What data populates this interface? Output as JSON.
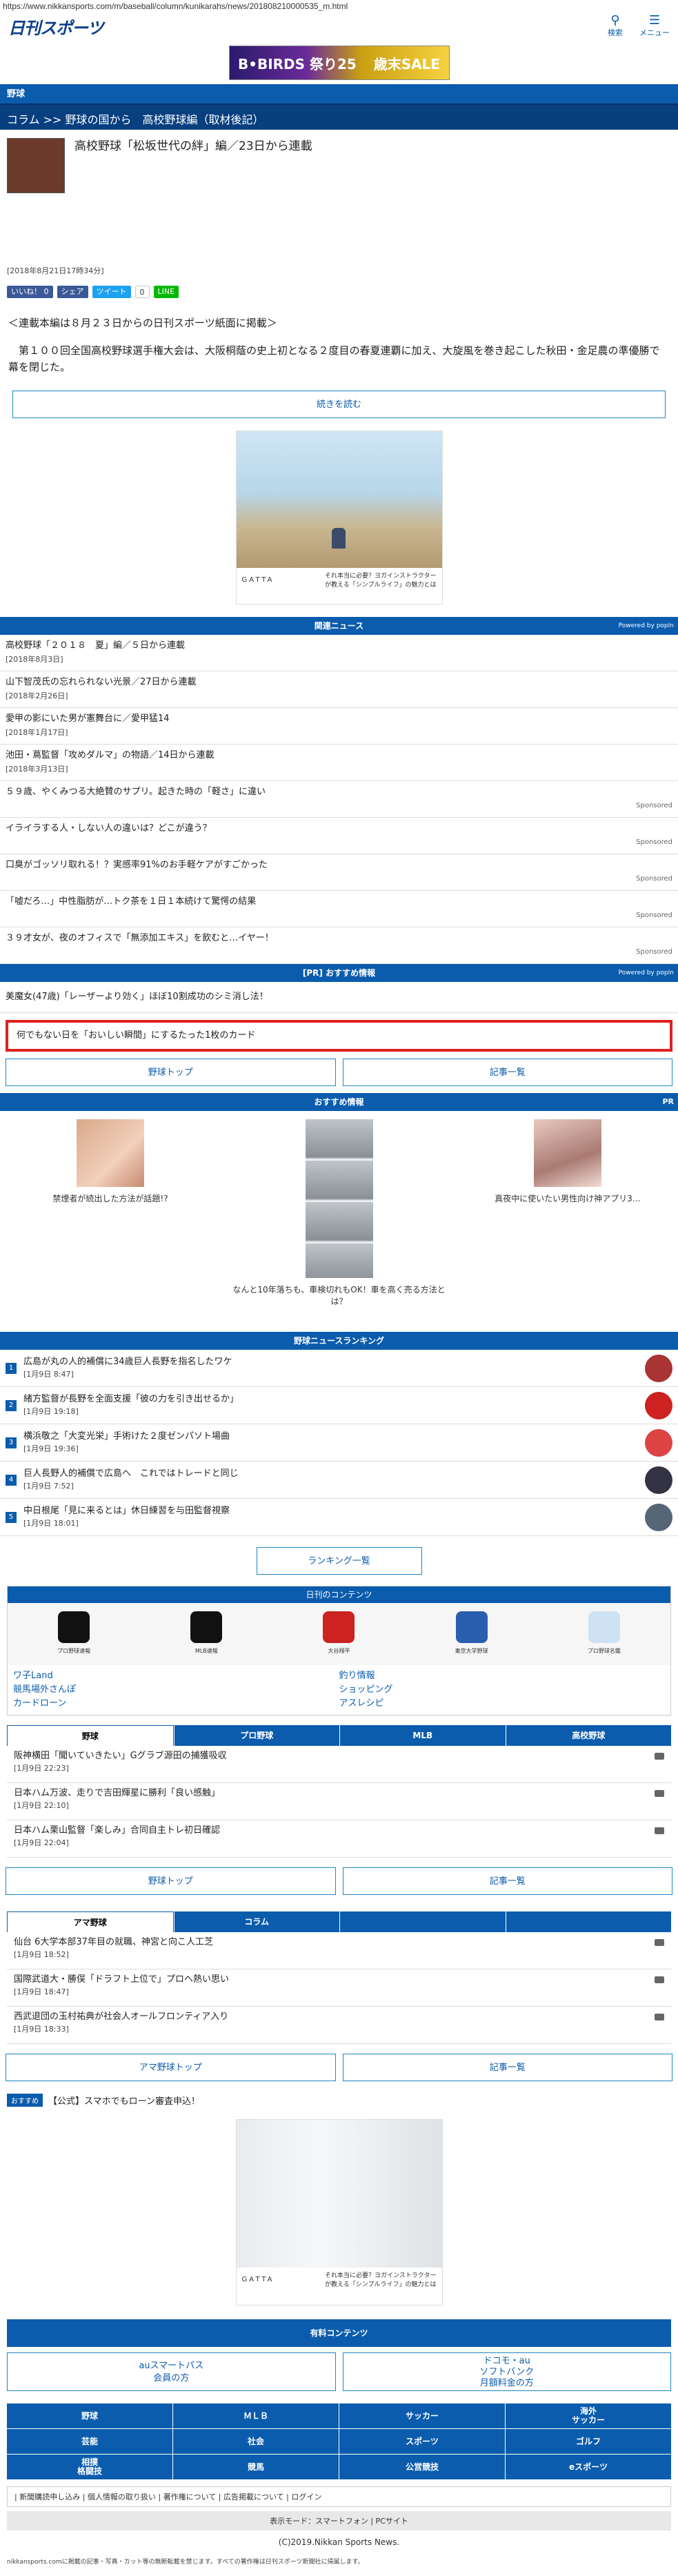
{
  "url": "https://www.nikkansports.com/m/baseball/column/kunikarahs/news/201808210000535_m.html",
  "header": {
    "logo": "日刊スポーツ",
    "search_label": "検索",
    "menu_label": "メニュー"
  },
  "banner": {
    "left": "B•BIRDS 祭り25",
    "right": "歳末SALE"
  },
  "section_title": "野球",
  "breadcrumb": "コラム >> 野球の国から　高校野球編（取材後記）",
  "article": {
    "title": "高校野球「松坂世代の絆」編／23日から連載",
    "date": "[2018年8月21日17時34分]",
    "lead1": "＜連載本編は８月２３日からの日刊スポーツ紙面に掲載＞",
    "lead2": "　第１００回全国高校野球選手権大会は、大阪桐蔭の史上初となる２度目の春夏連覇に加え、大旋風を巻き起こした秋田・金足農の準優勝で幕を閉じた。",
    "read_more": "続きを読む"
  },
  "share": {
    "fb": "いいね！ 0",
    "fb2": "シェア",
    "tw": "ツイート",
    "b": "0",
    "line": "LINE"
  },
  "ad1": {
    "brand": "GATTA",
    "caption": "それ本当に必要？ヨガインストラクターが教える「シンプルライフ」の魅力とは"
  },
  "related": {
    "heading": "関連ニュース",
    "powered": "Powered by popIn",
    "items": [
      {
        "t": "高校野球「２０１８　夏」編／５日から連載",
        "d": "[2018年8月3日]"
      },
      {
        "t": "山下智茂氏の忘れられない光景／27日から連載",
        "d": "[2018年2月26日]"
      },
      {
        "t": "愛甲の影にいた男が憲舞台に／愛甲猛14",
        "d": "[2018年1月17日]"
      },
      {
        "t": "池田・蔦監督「攻めダルマ」の物語／14日から連載",
        "d": "[2018年3月13日]"
      }
    ],
    "sponsored": [
      "５９歳、やくみつる大絶賛のサプリ。起きた時の「軽さ」に違い",
      "イライラする人・しない人の違いは？どこが違う？",
      "口臭がゴッソリ取れる！？実感率91%のお手軽ケアがすごかった",
      "「嘘だろ…」中性脂肪が…トク茶を１日１本続けて驚愕の結果",
      "３９才女が、夜のオフィスで「無添加エキス」を飲むと…イヤー！"
    ],
    "sponsored_label": "Sponsored"
  },
  "pr": {
    "heading": "[PR] おすすめ情報",
    "powered": "Powered by popIn",
    "item": "美魔女(47歳)「レーザーより効く」ほぼ10割成功のシミ消し法！"
  },
  "promo": "何でもない日を「おいしい瞬間」にするたった1枚のカード",
  "buttons": {
    "top": "野球トップ",
    "list": "記事一覧"
  },
  "osusume": {
    "heading": "おすすめ情報",
    "pr": "PR",
    "items": [
      "禁煙者が続出した方法が話題!?",
      "なんと10年落ちも、車検切れもOK！車を高く売る方法とは？",
      "真夜中に使いたい男性向け神アプリ3…"
    ]
  },
  "ranking": {
    "heading": "野球ニュースランキング",
    "items": [
      {
        "n": "1",
        "t": "広島が丸の人的補償に34歳巨人長野を指名したワケ",
        "d": "[1月9日 8:47]"
      },
      {
        "n": "2",
        "t": "緒方監督が長野を全面支援「彼の力を引き出せるか」",
        "d": "[1月9日 19:18]"
      },
      {
        "n": "3",
        "t": "横浜敬之「大変光栄」手術けた２度ゼンパソト場曲",
        "d": "[1月9日 19:36]"
      },
      {
        "n": "4",
        "t": "巨人長野人的補償で広島へ　これではトレードと同じ",
        "d": "[1月9日 7:52]"
      },
      {
        "n": "5",
        "t": "中日根尾「見に来るとは」休日練習を与田監督視察",
        "d": "[1月9日 18:01]"
      }
    ],
    "all_button": "ランキング一覧"
  },
  "my_content": {
    "heading": "日刊のコンテンツ",
    "icons": [
      "プロ野球速報",
      "MLB速報",
      "大谷翔平",
      "東京大学野球",
      "プロ野球名鑑"
    ],
    "links": [
      "ワ子Land",
      "釣り情報",
      "競馬場外さんぽ",
      "ショッピング",
      "カードローン",
      "アスレシピ"
    ]
  },
  "tabs1": [
    "野球",
    "プロ野球",
    "MLB",
    "高校野球"
  ],
  "news1": [
    {
      "t": "阪神横田「聞いていきたい」Gグラブ源田の捕獲吸収",
      "d": "[1月9日 22:23]"
    },
    {
      "t": "日本ハム万波、走りで吉田輝星に勝利「良い感触」",
      "d": "[1月9日 22:10]"
    },
    {
      "t": "日本ハム栗山監督「楽しみ」合同自主トレ初日確認",
      "d": "[1月9日 22:04]"
    }
  ],
  "tabs2": [
    "アマ野球",
    "コラム",
    "",
    ""
  ],
  "news2": [
    {
      "t": "仙台 6大学本部37年目の就職、神宮と向こ人工芝",
      "d": "[1月9日 18:52]"
    },
    {
      "t": "国際武道大・勝俣「ドラフト上位で」プロへ熱い思い",
      "d": "[1月9日 18:47]"
    },
    {
      "t": "西武退団の玉村祐典が社会人オールフロンティア入り",
      "d": "[1月9日 18:33]"
    }
  ],
  "buttons2": {
    "top": "アマ野球トップ",
    "list": "記事一覧"
  },
  "osusume2": {
    "tag": "おすすめ",
    "text": "【公式】スマホでもローン審査申込！"
  },
  "ad2": {
    "brand": "GATTA",
    "caption": "それ本当に必要？ヨガインストラクターが教える「シンプルライフ」の魅力とは"
  },
  "paid": {
    "heading": "有料コンテンツ",
    "left": "auスマートパス\n会員の方",
    "right": "ドコモ・au\nソフトバンク\n月額料金の方"
  },
  "footer_nav": [
    "野球",
    "ＭＬＢ",
    "サッカー",
    "海外\nサッカー",
    "芸能",
    "社会",
    "スポーツ",
    "ゴルフ",
    "相撲\n格闘技",
    "競馬",
    "公営競技",
    "eスポーツ"
  ],
  "footer_links": "| 新聞購読申し込み | 個人情報の取り扱い | 著作権について | 広告掲載について | ログイン",
  "display_mode": "表示モード：スマートフォン | PCサイト",
  "copyright": "(C)2019.Nikkan Sports News.",
  "legal": "nikkansports.comに掲載の記事・写真・カット等の無断転載を禁じます。すべての著作権は日刊スポーツ新聞社に帰属します。"
}
